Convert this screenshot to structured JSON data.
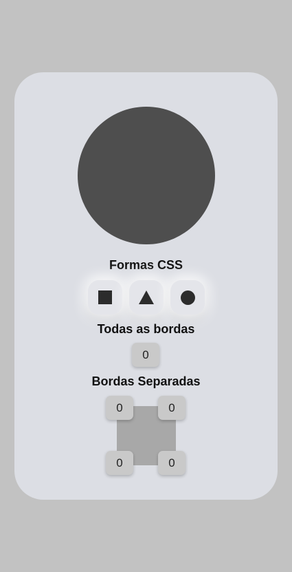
{
  "preview": {
    "shape": "circle",
    "color": "#4e4e4e"
  },
  "shapes": {
    "title": "Formas CSS",
    "buttons": [
      {
        "name": "square",
        "icon": "square-icon"
      },
      {
        "name": "triangle",
        "icon": "triangle-icon"
      },
      {
        "name": "circle",
        "icon": "circle-icon"
      }
    ]
  },
  "all_borders": {
    "title": "Todas as bordas",
    "value": "0"
  },
  "separate_borders": {
    "title": "Bordas Separadas",
    "top_left": "0",
    "top_right": "0",
    "bottom_left": "0",
    "bottom_right": "0"
  },
  "colors": {
    "background": "#c2c2c2",
    "card": "#dcdee4",
    "shape": "#4e4e4e",
    "input": "#c9c9c9",
    "square_preview": "#a8a8a8"
  }
}
